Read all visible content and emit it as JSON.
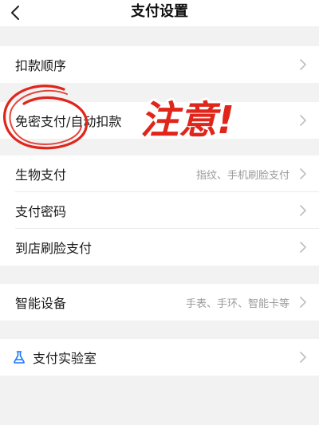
{
  "header": {
    "title": "支付设置"
  },
  "rows": {
    "deduction_order": {
      "label": "扣款顺序"
    },
    "password_free": {
      "label": "免密支付/自动扣款"
    },
    "biometric": {
      "label": "生物支付",
      "value": "指纹、手机刷脸支付"
    },
    "pay_password": {
      "label": "支付密码"
    },
    "in_store_face": {
      "label": "到店刷脸支付"
    },
    "smart_device": {
      "label": "智能设备",
      "value": "手表、手环、智能卡等"
    },
    "pay_lab": {
      "label": "支付实验室"
    }
  },
  "annotation": {
    "text": "注意!"
  },
  "colors": {
    "accent_blue": "#1677ff",
    "annotation_red": "#e0251b",
    "background": "#f2f2f2"
  },
  "icons": {
    "back": "chevron-left-icon",
    "row_arrow": "chevron-right-icon",
    "lab": "flask-icon"
  }
}
